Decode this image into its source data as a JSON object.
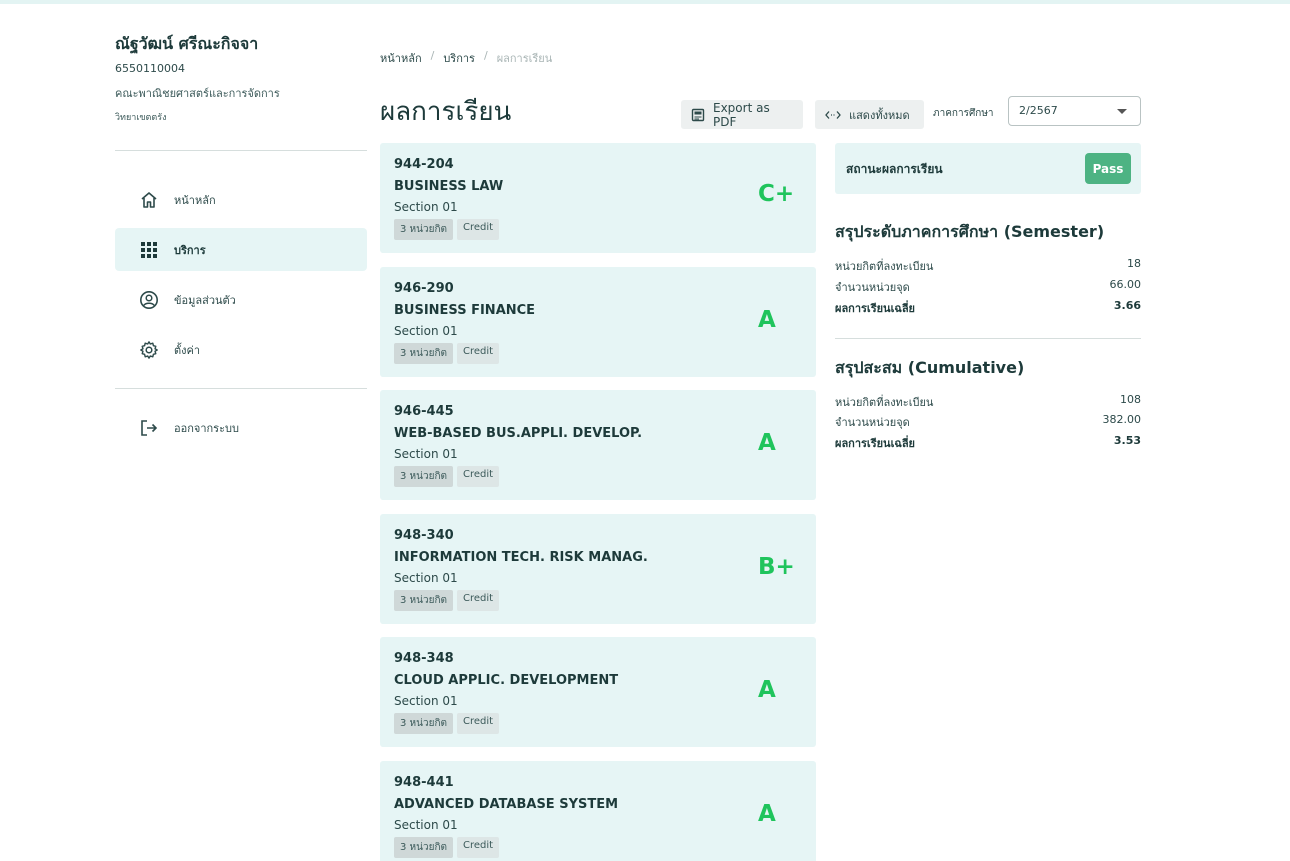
{
  "user": {
    "name": "ณัฐวัฒน์ ศรีณะกิจจา",
    "id": "6550110004",
    "faculty": "คณะพาณิชยศาสตร์และการจัดการ",
    "campus": "วิทยาเขตตรัง"
  },
  "sidebar": {
    "items": [
      {
        "label": "หน้าหลัก",
        "icon": "home-icon"
      },
      {
        "label": "บริการ",
        "icon": "grid-icon"
      },
      {
        "label": "ข้อมูลส่วนตัว",
        "icon": "account-icon"
      },
      {
        "label": "ตั้งค่า",
        "icon": "gear-icon"
      }
    ],
    "logout_label": "ออกจากระบบ"
  },
  "breadcrumb": [
    "หน้าหลัก",
    "บริการ",
    "ผลการเรียน"
  ],
  "page_title": "ผลการเรียน",
  "toolbar": {
    "export_label": "Export as PDF",
    "show_all_label": "แสดงทั้งหมด",
    "semester_label": "ภาคการศึกษา",
    "semester_value": "2/2567"
  },
  "courses": [
    {
      "code": "944-204",
      "name": "BUSINESS LAW",
      "section": "Section 01",
      "credits": "3 หน่วยกิต",
      "credit_label": "Credit",
      "grade": "C+"
    },
    {
      "code": "946-290",
      "name": "BUSINESS FINANCE",
      "section": "Section 01",
      "credits": "3 หน่วยกิต",
      "credit_label": "Credit",
      "grade": "A"
    },
    {
      "code": "946-445",
      "name": "WEB-BASED BUS.APPLI. DEVELOP.",
      "section": "Section 01",
      "credits": "3 หน่วยกิต",
      "credit_label": "Credit",
      "grade": "A"
    },
    {
      "code": "948-340",
      "name": "INFORMATION TECH. RISK MANAG.",
      "section": "Section 01",
      "credits": "3 หน่วยกิต",
      "credit_label": "Credit",
      "grade": "B+"
    },
    {
      "code": "948-348",
      "name": "CLOUD APPLIC. DEVELOPMENT",
      "section": "Section 01",
      "credits": "3 หน่วยกิต",
      "credit_label": "Credit",
      "grade": "A"
    },
    {
      "code": "948-441",
      "name": "ADVANCED DATABASE SYSTEM",
      "section": "Section 01",
      "credits": "3 หน่วยกิต",
      "credit_label": "Credit",
      "grade": "A"
    }
  ],
  "status": {
    "label": "สถานะผลการเรียน",
    "value": "Pass"
  },
  "semester_summary": {
    "title": "สรุประดับภาคการศึกษา (Semester)",
    "rows": [
      {
        "label": "หน่วยกิตที่ลงทะเบียน",
        "value": "18"
      },
      {
        "label": "จำนวนหน่วยจุด",
        "value": "66.00"
      },
      {
        "label": "ผลการเรียนเฉลี่ย",
        "value": "3.66"
      }
    ]
  },
  "cumulative_summary": {
    "title": "สรุปสะสม (Cumulative)",
    "rows": [
      {
        "label": "หน่วยกิตที่ลงทะเบียน",
        "value": "108"
      },
      {
        "label": "จำนวนหน่วยจุด",
        "value": "382.00"
      },
      {
        "label": "ผลการเรียนเฉลี่ย",
        "value": "3.53"
      }
    ]
  },
  "colors": {
    "accent_bg": "#e6f5f5",
    "grade_green": "#1fc45c",
    "pass_badge": "#4db383"
  }
}
